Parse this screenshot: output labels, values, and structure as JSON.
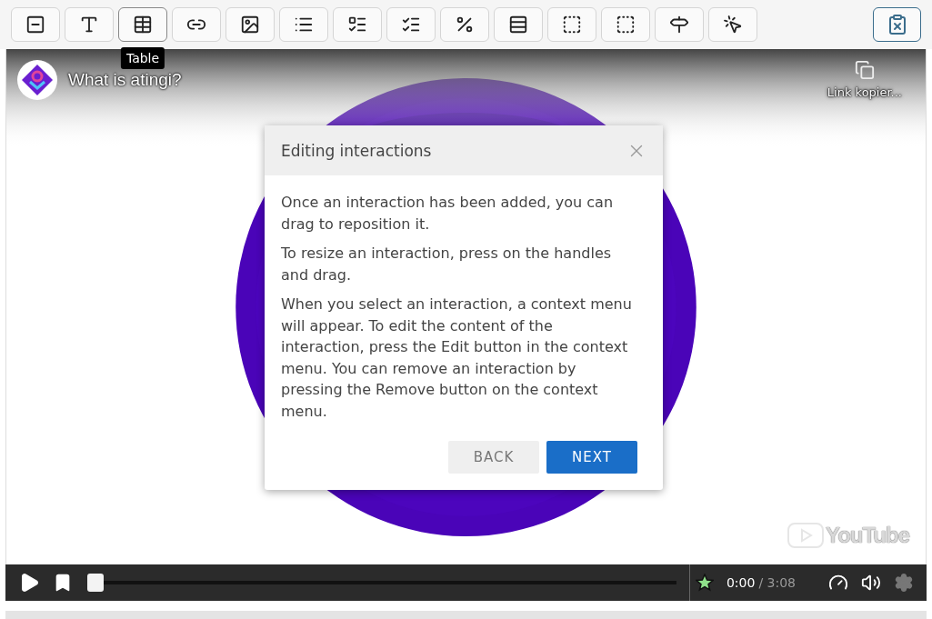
{
  "toolbar": {
    "buttons": [
      {
        "hovered": false
      },
      {
        "hovered": false
      },
      {
        "hovered": true
      },
      {
        "hovered": false
      },
      {
        "hovered": false
      },
      {
        "hovered": false
      },
      {
        "hovered": false
      },
      {
        "hovered": false
      },
      {
        "hovered": false
      },
      {
        "hovered": false
      },
      {
        "hovered": false
      },
      {
        "hovered": false
      },
      {
        "hovered": false
      },
      {
        "hovered": false
      }
    ],
    "tooltip": "Table"
  },
  "video": {
    "title": "What is atingi?",
    "share_label": "Link kopier...",
    "logo_text": "YouTube"
  },
  "dialog": {
    "title": "Editing interactions",
    "paragraphs": [
      "Once an interaction has been added, you can drag to reposition it.",
      "To resize an interaction, press on the handles and drag.",
      "When you select an interaction, a context menu will appear. To edit the content of the interaction, press the Edit button in the context menu. You can remove an interaction by pressing the Remove button on the context menu."
    ],
    "buttons": [
      {
        "label": "BACK",
        "kind": "secondary"
      },
      {
        "label": "NEXT",
        "kind": "primary"
      }
    ]
  },
  "player": {
    "level": 0,
    "current_time": "0:00",
    "duration": "/ 3:08"
  }
}
